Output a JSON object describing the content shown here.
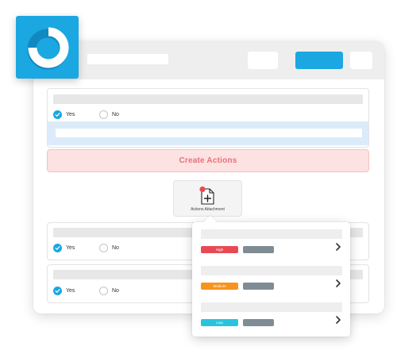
{
  "colors": {
    "accent": "#1aa7e2",
    "high": "#e84a55",
    "medium": "#f7941d",
    "low": "#29c4dc",
    "tag_gray": "#7f8c94",
    "create_actions_bg": "#fde2e2",
    "create_actions_text": "#e9707a"
  },
  "icons": {
    "logo": "ring-logo-icon",
    "attachment": "file-add-icon",
    "check": "check-icon",
    "chevron": "chevron-right-icon"
  },
  "questions": [
    {
      "yes_label": "Yes",
      "no_label": "No",
      "selected": "Yes"
    },
    {
      "yes_label": "Yes",
      "no_label": "No",
      "selected": "Yes"
    },
    {
      "yes_label": "Yes",
      "no_label": "No",
      "selected": "Yes"
    }
  ],
  "create_actions_label": "Create Actions",
  "attachment": {
    "label": "Actions Attachment"
  },
  "priority_menu": [
    {
      "label": "High",
      "color": "#e84a55"
    },
    {
      "label": "Medium",
      "color": "#f7941d"
    },
    {
      "label": "Low",
      "color": "#29c4dc"
    }
  ]
}
